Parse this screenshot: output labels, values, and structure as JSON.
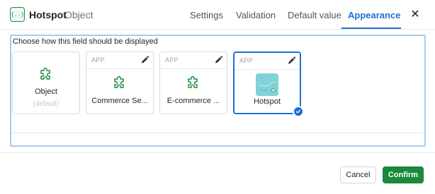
{
  "header": {
    "field_icon_glyph": "{..}",
    "field_name": "Hotspot",
    "field_type": "Object",
    "tabs": [
      {
        "label": "Settings",
        "active": false
      },
      {
        "label": "Validation",
        "active": false
      },
      {
        "label": "Default value",
        "active": false
      },
      {
        "label": "Appearance",
        "active": true
      }
    ],
    "close_glyph": "✕"
  },
  "main": {
    "prompt": "Choose how this field should be displayed",
    "options": [
      {
        "label": "Object",
        "sublabel": "(default)",
        "tag": "",
        "icon": "puzzle-icon",
        "selected": false
      },
      {
        "label": "Commerce Se...",
        "sublabel": "",
        "tag": "APP",
        "icon": "puzzle-icon",
        "selected": false
      },
      {
        "label": "E-commerce ...",
        "sublabel": "",
        "tag": "APP",
        "icon": "puzzle-icon",
        "selected": false
      },
      {
        "label": "Hotspot",
        "sublabel": "",
        "tag": "APP",
        "icon": "hotspot-thumbnail",
        "selected": true
      }
    ]
  },
  "footer": {
    "cancel_label": "Cancel",
    "confirm_label": "Confirm"
  },
  "colors": {
    "accent": "#1f6fd6",
    "confirm": "#1a8a3a",
    "selected_border": "#1f6fd6",
    "thumbnail": "#7fd3d6"
  }
}
